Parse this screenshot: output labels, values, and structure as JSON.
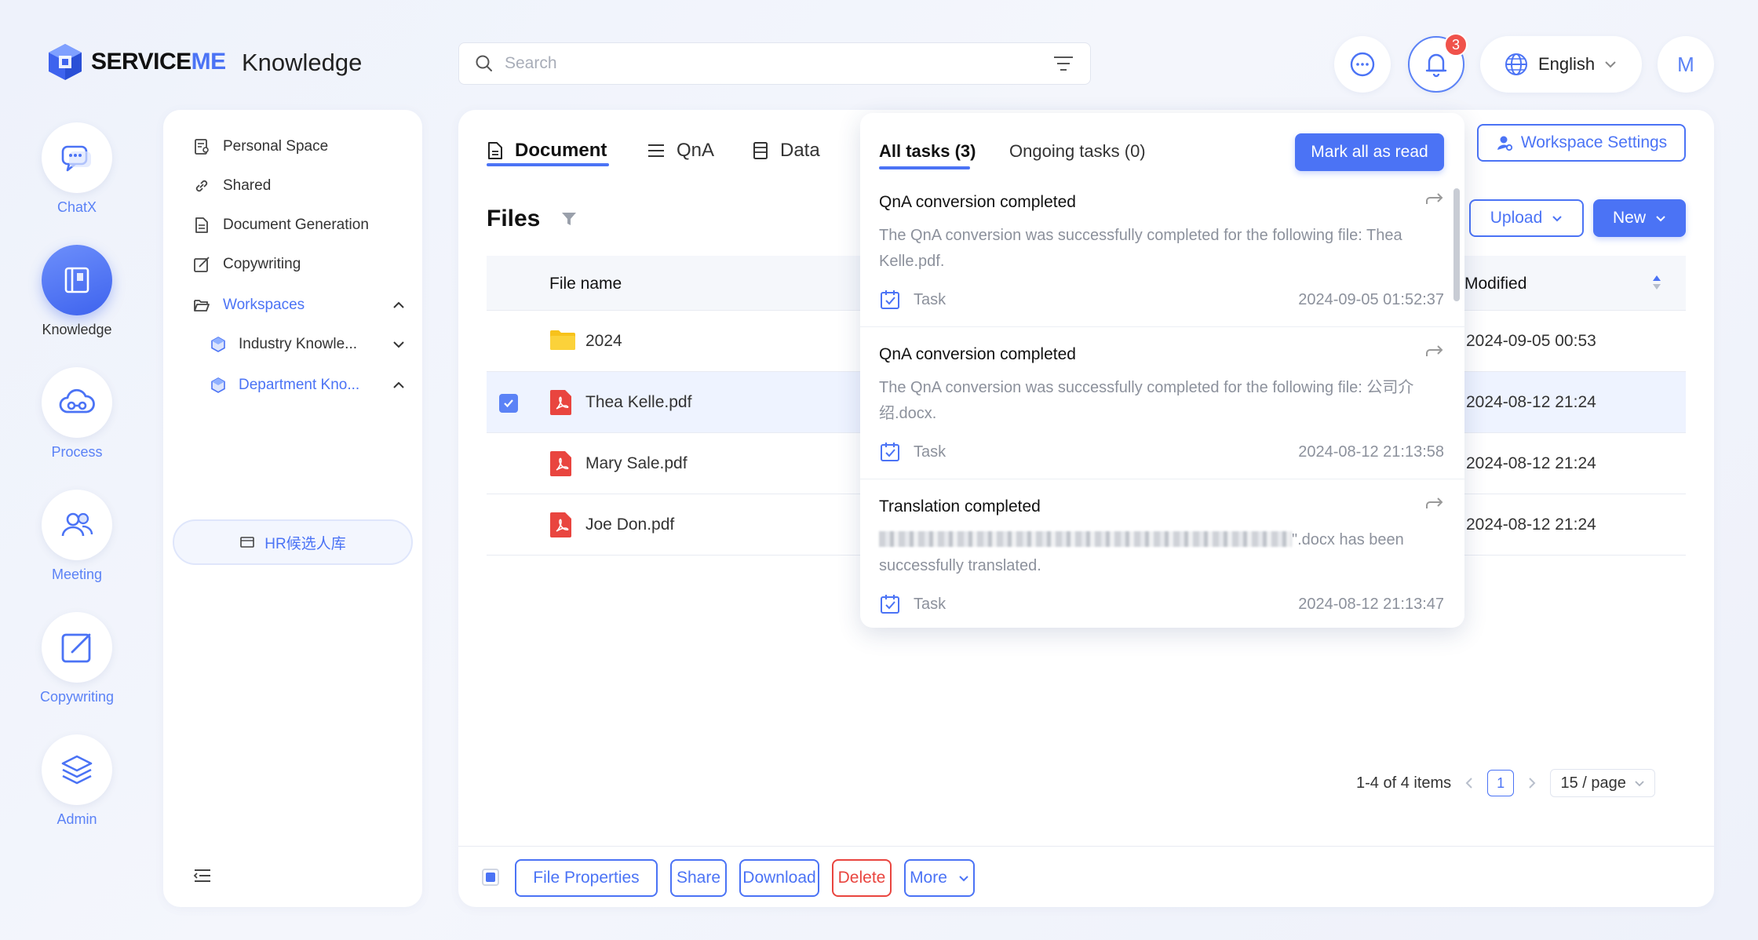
{
  "header": {
    "logo_text_a": "SERVICE",
    "logo_text_b": "ME",
    "app_title": "Knowledge",
    "search_placeholder": "Search",
    "notification_count": "3",
    "language": "English",
    "avatar_initial": "M"
  },
  "rail": {
    "items": [
      {
        "label": "ChatX",
        "icon": "chat-bubble-icon"
      },
      {
        "label": "Knowledge",
        "icon": "book-icon",
        "active": true
      },
      {
        "label": "Process",
        "icon": "cloud-process-icon"
      },
      {
        "label": "Meeting",
        "icon": "people-icon"
      },
      {
        "label": "Copywriting",
        "icon": "edit-square-icon"
      },
      {
        "label": "Admin",
        "icon": "layers-icon"
      }
    ]
  },
  "sidebar": {
    "items": [
      {
        "label": "Personal Space",
        "icon": "person-doc-icon"
      },
      {
        "label": "Shared",
        "icon": "link-icon"
      },
      {
        "label": "Document Generation",
        "icon": "document-icon"
      },
      {
        "label": "Copywriting",
        "icon": "edit-icon"
      },
      {
        "label": "Workspaces",
        "icon": "folder-open-icon"
      },
      {
        "label": "Industry Knowle...",
        "icon": "cube-icon"
      },
      {
        "label": "Department Kno...",
        "icon": "cube-icon"
      }
    ],
    "selected_sub": "HR候选人库"
  },
  "main": {
    "tabs": [
      {
        "label": "Document",
        "icon": "document-icon",
        "active": true
      },
      {
        "label": "QnA",
        "icon": "list-icon"
      },
      {
        "label": "Data",
        "icon": "database-icon"
      }
    ],
    "workspace_settings": "Workspace Settings",
    "files_title": "Files",
    "upload_label": "Upload",
    "new_label": "New",
    "columns": {
      "name": "File name",
      "modified": "Modified"
    },
    "rows": [
      {
        "name": "2024",
        "type": "folder",
        "modified": "2024-09-05 00:53",
        "selected": false
      },
      {
        "name": "Thea Kelle.pdf",
        "type": "pdf",
        "modified": "2024-08-12 21:24",
        "selected": true
      },
      {
        "name": "Mary Sale.pdf",
        "type": "pdf",
        "modified": "2024-08-12 21:24",
        "selected": false
      },
      {
        "name": "Joe Don.pdf",
        "type": "pdf",
        "modified": "2024-08-12 21:24",
        "selected": false
      }
    ],
    "pagination": {
      "summary": "1-4 of 4 items",
      "current": "1",
      "page_size": "15 / page"
    },
    "footer": {
      "file_properties": "File Properties",
      "share": "Share",
      "download": "Download",
      "delete": "Delete",
      "more": "More"
    }
  },
  "notifications": {
    "tab_all": "All tasks (3)",
    "tab_ongoing": "Ongoing tasks (0)",
    "mark_all": "Mark all as read",
    "items": [
      {
        "title": "QnA conversion completed",
        "body": "The QnA conversion was successfully completed for the following file: Thea Kelle.pdf.",
        "tag": "Task",
        "time": "2024-09-05 01:52:37"
      },
      {
        "title": "QnA conversion completed",
        "body": "The QnA conversion was successfully completed for the following file: 公司介绍.docx.",
        "tag": "Task",
        "time": "2024-08-12 21:13:58"
      },
      {
        "title": "Translation completed",
        "body_suffix": "\".docx has been successfully translated.",
        "tag": "Task",
        "time": "2024-08-12 21:13:47"
      }
    ]
  },
  "colors": {
    "accent": "#4b73f5",
    "danger": "#e9453f",
    "badge": "#f0524b"
  }
}
